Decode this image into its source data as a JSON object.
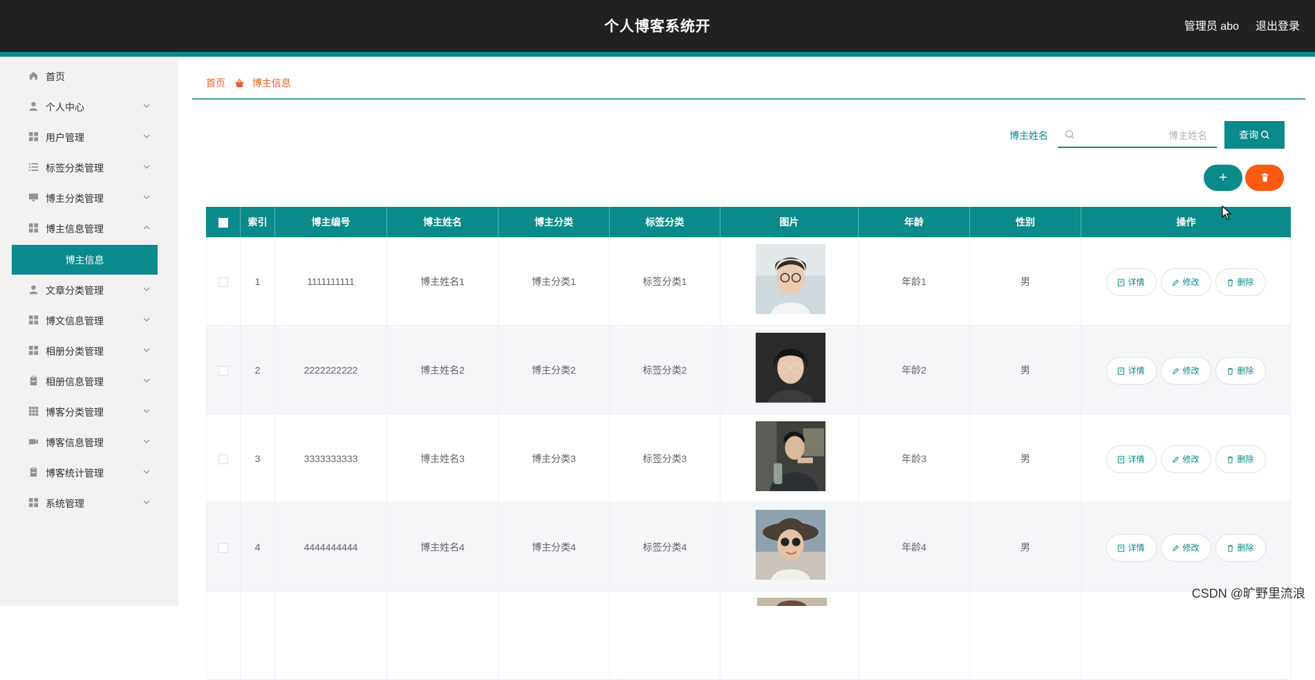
{
  "header": {
    "title": "个人博客系统开",
    "user": "管理员 abo",
    "logout": "退出登录"
  },
  "sidebar": {
    "items": [
      {
        "label": "首页",
        "icon": "home-icon"
      },
      {
        "label": "个人中心",
        "icon": "user-icon"
      },
      {
        "label": "用户管理",
        "icon": "grid-icon"
      },
      {
        "label": "标签分类管理",
        "icon": "list-icon"
      },
      {
        "label": "博主分类管理",
        "icon": "monitor-icon"
      },
      {
        "label": "博主信息管理",
        "icon": "grid-icon"
      },
      {
        "label": "文章分类管理",
        "icon": "user-icon"
      },
      {
        "label": "博文信息管理",
        "icon": "grid-icon"
      },
      {
        "label": "相册分类管理",
        "icon": "grid-icon"
      },
      {
        "label": "相册信息管理",
        "icon": "clipboard-icon"
      },
      {
        "label": "博客分类管理",
        "icon": "apps-icon"
      },
      {
        "label": "博客信息管理",
        "icon": "video-icon"
      },
      {
        "label": "博客统计管理",
        "icon": "clipboard-icon"
      },
      {
        "label": "系统管理",
        "icon": "grid-icon"
      }
    ],
    "active_sub": "博主信息"
  },
  "breadcrumb": {
    "home": "首页",
    "current": "博主信息"
  },
  "search": {
    "label": "博主姓名",
    "placeholder": "博主姓名",
    "button": "查询"
  },
  "actions": {
    "add": "+"
  },
  "table": {
    "columns": [
      "索引",
      "博主编号",
      "博主姓名",
      "博主分类",
      "标签分类",
      "图片",
      "年龄",
      "性别",
      "操作"
    ],
    "rows": [
      {
        "index": "1",
        "code": "1111111111",
        "name": "博主姓名1",
        "category": "博主分类1",
        "tag": "标签分类1",
        "age": "年龄1",
        "gender": "男"
      },
      {
        "index": "2",
        "code": "2222222222",
        "name": "博主姓名2",
        "category": "博主分类2",
        "tag": "标签分类2",
        "age": "年龄2",
        "gender": "男"
      },
      {
        "index": "3",
        "code": "3333333333",
        "name": "博主姓名3",
        "category": "博主分类3",
        "tag": "标签分类3",
        "age": "年龄3",
        "gender": "男"
      },
      {
        "index": "4",
        "code": "4444444444",
        "name": "博主姓名4",
        "category": "博主分类4",
        "tag": "标签分类4",
        "age": "年龄4",
        "gender": "男"
      }
    ],
    "row_actions": {
      "detail": "详情",
      "edit": "修改",
      "delete": "删除"
    }
  },
  "watermark": "CSDN @旷野里流浪",
  "colors": {
    "primary": "#0a8a8a",
    "danger": "#fa5b10",
    "topbar": "#212121",
    "breadcrumb": "#e8622b"
  }
}
